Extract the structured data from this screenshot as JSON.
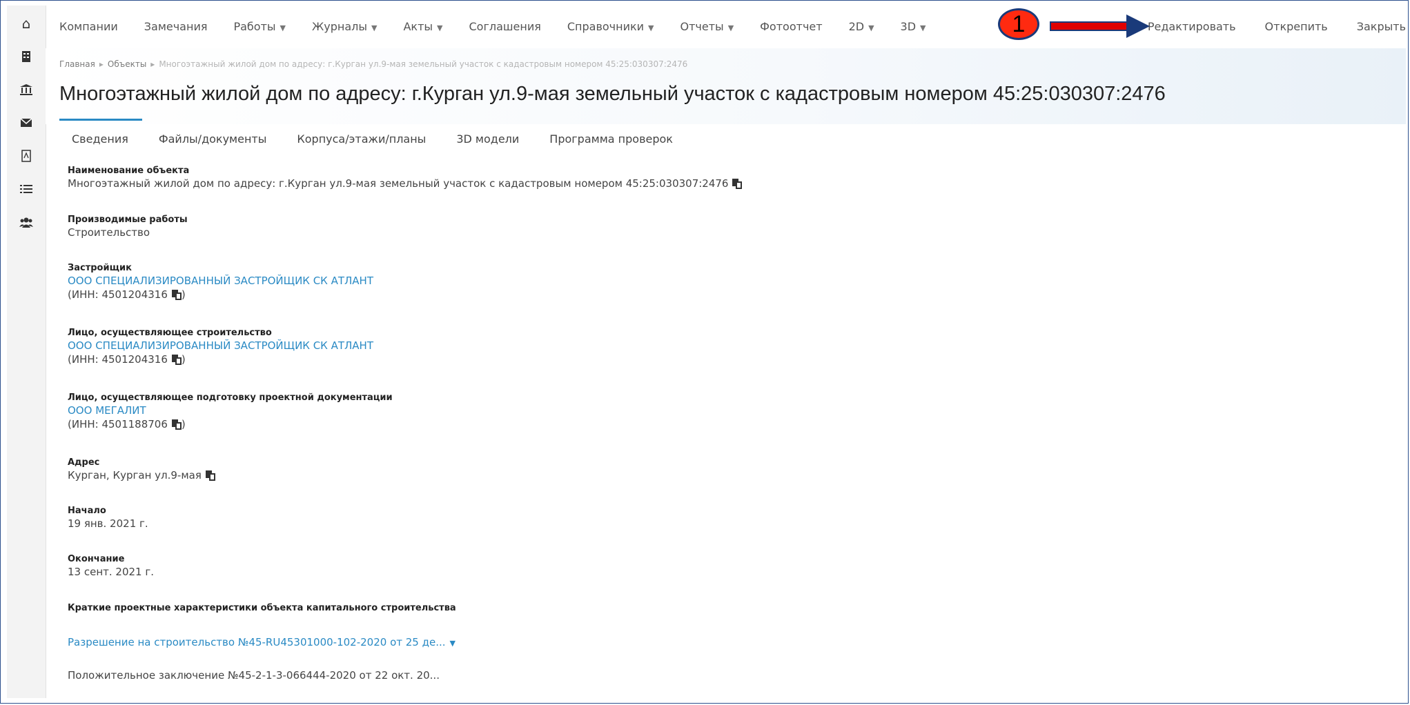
{
  "nav": {
    "items": [
      {
        "label": "Компании",
        "dropdown": false
      },
      {
        "label": "Замечания",
        "dropdown": false
      },
      {
        "label": "Работы",
        "dropdown": true
      },
      {
        "label": "Журналы",
        "dropdown": true
      },
      {
        "label": "Акты",
        "dropdown": true
      },
      {
        "label": "Соглашения",
        "dropdown": false
      },
      {
        "label": "Справочники",
        "dropdown": true
      },
      {
        "label": "Отчеты",
        "dropdown": true
      },
      {
        "label": "Фотоотчет",
        "dropdown": false
      },
      {
        "label": "2D",
        "dropdown": true
      },
      {
        "label": "3D",
        "dropdown": true
      }
    ],
    "actions": {
      "edit": "Редактировать",
      "unpin": "Открепить",
      "close": "Закрыть"
    }
  },
  "annotation": {
    "number": "1",
    "colors": {
      "marker": "#ff2a10",
      "arrow": "#e00000",
      "outline": "#1a3a7a"
    }
  },
  "sidebar": {
    "icons": [
      "home-icon",
      "building-icon",
      "bank-icon",
      "envelope-icon",
      "pdf-icon",
      "list-icon",
      "users-icon"
    ]
  },
  "breadcrumb": {
    "home": "Главная",
    "objects": "Объекты",
    "current": "Многоэтажный жилой дом по адресу: г.Курган ул.9-мая земельный участок с кадастровым номером 45:25:030307:2476"
  },
  "page": {
    "title": "Многоэтажный жилой дом по адресу: г.Курган ул.9-мая земельный участок с кадастровым номером 45:25:030307:2476"
  },
  "tabs": [
    "Сведения",
    "Файлы/документы",
    "Корпуса/этажи/планы",
    "3D модели",
    "Программа проверок"
  ],
  "fields": {
    "name": {
      "label": "Наименование объекта",
      "value": "Многоэтажный жилой дом по адресу: г.Курган ул.9-мая земельный участок с кадастровым номером 45:25:030307:2476"
    },
    "works": {
      "label": "Производимые работы",
      "value": "Строительство"
    },
    "developer": {
      "label": "Застройщик",
      "company": "ООО СПЕЦИАЛИЗИРОВАННЫЙ ЗАСТРОЙЩИК СК АТЛАНТ",
      "inn": "(ИНН: 4501204316"
    },
    "builder": {
      "label": "Лицо, осуществляющее строительство",
      "company": "ООО СПЕЦИАЛИЗИРОВАННЫЙ ЗАСТРОЙЩИК СК АТЛАНТ",
      "inn": "(ИНН: 4501204316"
    },
    "designer": {
      "label": "Лицо, осуществляющее подготовку проектной документации",
      "company": "ООО МЕГАЛИТ",
      "inn": "(ИНН: 4501188706"
    },
    "address": {
      "label": "Адрес",
      "value": "Курган, Курган ул.9-мая"
    },
    "start": {
      "label": "Начало",
      "value": "19 янв. 2021 г."
    },
    "end": {
      "label": "Окончание",
      "value": "13 сент. 2021 г."
    },
    "characteristics": {
      "label": "Краткие проектные характеристики объекта капитального строительства"
    },
    "permit": {
      "value": "Разрешение на строительство №45-RU45301000-102-2020 от 25 де..."
    },
    "conclusion": {
      "value": "Положительное заключение №45-2-1-3-066444-2020 от 22 окт. 20..."
    }
  },
  "inn_close": ")"
}
